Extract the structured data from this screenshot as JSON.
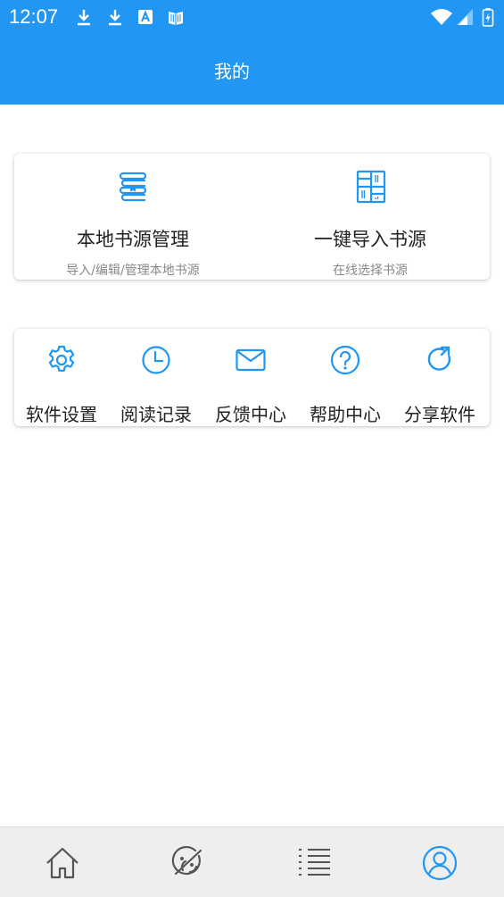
{
  "status_bar": {
    "time": "12:07",
    "icons": [
      "download-icon",
      "download-icon",
      "font-a-icon",
      "book-icon",
      "wifi-icon",
      "signal-icon",
      "battery-icon"
    ]
  },
  "header": {
    "title": "我的"
  },
  "sources": [
    {
      "title": "本地书源管理",
      "subtitle": "导入/编辑/管理本地书源",
      "icon": "books-stack-icon"
    },
    {
      "title": "一键导入书源",
      "subtitle": "在线选择书源",
      "icon": "bookshelf-icon"
    }
  ],
  "tools": [
    {
      "label": "软件设置",
      "icon": "gear-icon"
    },
    {
      "label": "阅读记录",
      "icon": "clock-icon"
    },
    {
      "label": "反馈中心",
      "icon": "mail-icon"
    },
    {
      "label": "帮助中心",
      "icon": "help-icon"
    },
    {
      "label": "分享软件",
      "icon": "share-icon"
    }
  ],
  "bottom_nav": [
    {
      "icon": "home-icon",
      "active": false
    },
    {
      "icon": "discover-icon",
      "active": false
    },
    {
      "icon": "list-icon",
      "active": false
    },
    {
      "icon": "profile-icon",
      "active": true
    }
  ],
  "colors": {
    "accent": "#2196F3",
    "nav_inactive": "#555555",
    "text": "#222222",
    "subtext": "#888888"
  }
}
